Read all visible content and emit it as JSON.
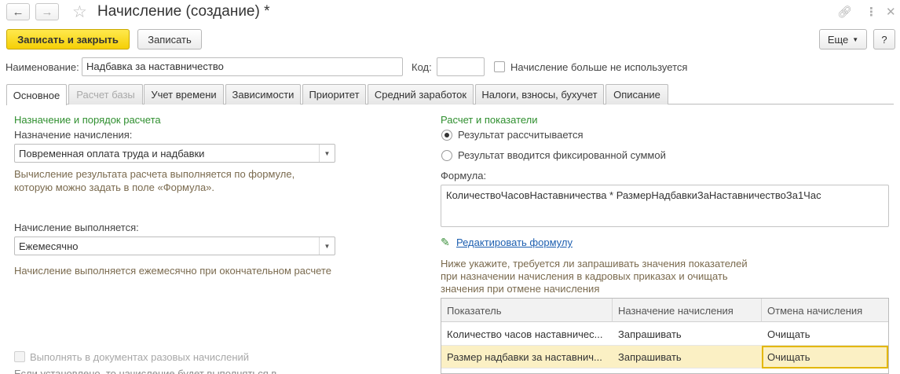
{
  "window": {
    "title": "Начисление (создание) *"
  },
  "toolbar": {
    "save_close_label": "Записать и закрыть",
    "save_label": "Записать",
    "more_label": "Еще",
    "help_label": "?"
  },
  "header": {
    "name_label": "Наименование:",
    "name_value": "Надбавка за наставничество",
    "code_label": "Код:",
    "code_value": "",
    "unused_label": "Начисление больше не используется"
  },
  "tabs": [
    {
      "label": "Основное",
      "state": "active"
    },
    {
      "label": "Расчет базы",
      "state": "disabled"
    },
    {
      "label": "Учет времени",
      "state": "normal"
    },
    {
      "label": "Зависимости",
      "state": "normal"
    },
    {
      "label": "Приоритет",
      "state": "normal"
    },
    {
      "label": "Средний заработок",
      "state": "normal"
    },
    {
      "label": "Налоги, взносы, бухучет",
      "state": "normal"
    },
    {
      "label": "Описание",
      "state": "normal"
    }
  ],
  "left": {
    "section_title": "Назначение и порядок расчета",
    "purpose_label": "Назначение начисления:",
    "purpose_value": "Повременная оплата труда и надбавки",
    "purpose_note_1": "Вычисление результата расчета выполняется по формуле,",
    "purpose_note_2": "которую можно задать в поле «Формула».",
    "performed_label": "Начисление выполняется:",
    "performed_value": "Ежемесячно",
    "performed_note": "Начисление выполняется ежемесячно при окончательном расчете",
    "one_time_label": "Выполнять в документах разовых начислений",
    "one_time_note": "Если установлено, то начисление будет выполняться в"
  },
  "right": {
    "section_title": "Расчет и показатели",
    "radio_calculated": "Результат рассчитывается",
    "radio_fixed": "Результат вводится фиксированной суммой",
    "formula_label": "Формула:",
    "formula_value": "КоличествоЧасовНаставничества * РазмерНадбавкиЗаНаставничествоЗа1Час",
    "edit_formula_link": "Редактировать формулу",
    "hint_1": "Ниже укажите, требуется ли запрашивать значения показателей",
    "hint_2": "при назначении начисления в кадровых приказах и очищать",
    "hint_3": "значения при отмене начисления",
    "table": {
      "columns": [
        "Показатель",
        "Назначение начисления",
        "Отмена начисления"
      ],
      "rows": [
        [
          "Количество часов наставничес...",
          "Запрашивать",
          "Очищать"
        ],
        [
          "Размер надбавки за наставнич...",
          "Запрашивать",
          "Очищать"
        ]
      ]
    }
  },
  "colors": {
    "accent_yellow": "#f5cf05",
    "section_green": "#2f8f2f",
    "link_blue": "#1d5fb0",
    "note_brown": "#7a6a4e",
    "selected_row": "#fbf0c4"
  }
}
